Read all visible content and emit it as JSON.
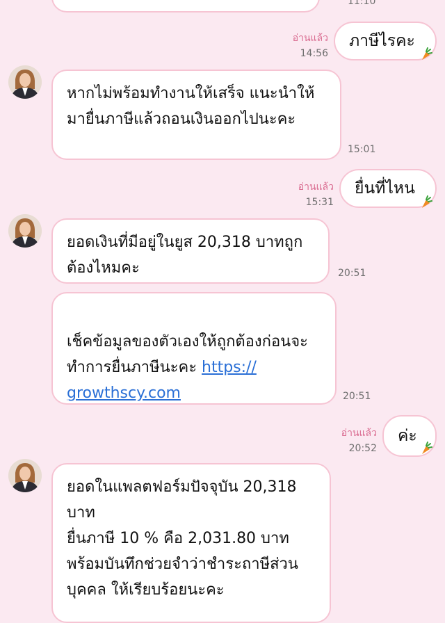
{
  "messages": {
    "m0": {
      "time": "11:10"
    },
    "m1": {
      "text": "ภาษีไรคะ",
      "read": "อ่านแล้ว",
      "time": "14:56"
    },
    "m2": {
      "text": "หากไม่พร้อมทำงานให้เสร็จ แนะนำให้\nมายื่นภาษีแล้วถอนเงินออกไปนะคะ",
      "time": "15:01"
    },
    "m3": {
      "text": "ยื่นที่ไหน",
      "read": "อ่านแล้ว",
      "time": "15:31"
    },
    "m4": {
      "text": "ยอดเงินที่มีอยู่ในยูส 20,318 บาทถูก\nต้องไหมคะ",
      "time": "20:51"
    },
    "m5": {
      "text": "เช็คข้อมูลของตัวเองให้ถูกต้องก่อนจะ\nทำการยื่นภาษีนะคะ ",
      "link_part1": "https://",
      "link_part2": "growthscy.com",
      "time": "20:51"
    },
    "m6": {
      "text": "ค่ะ",
      "read": "อ่านแล้ว",
      "time": "20:52"
    },
    "m7": {
      "text": "ยอดในแพลตฟอร์มปัจจุบัน 20,318\nบาท\nยื่นภาษี 10 % คือ 2,031.80  บาท\nพร้อมบันทึกช่วยจำว่าชำระถาษีส่วน\nบุคคล  ให้เรียบร้อยนะคะ"
    }
  },
  "colors": {
    "background": "#fbe9f1",
    "bubble_border": "#f6c4d3",
    "read_text": "#d96a8f",
    "link": "#2a6fd6"
  },
  "icons": [
    "carrot-icon",
    "avatar"
  ]
}
